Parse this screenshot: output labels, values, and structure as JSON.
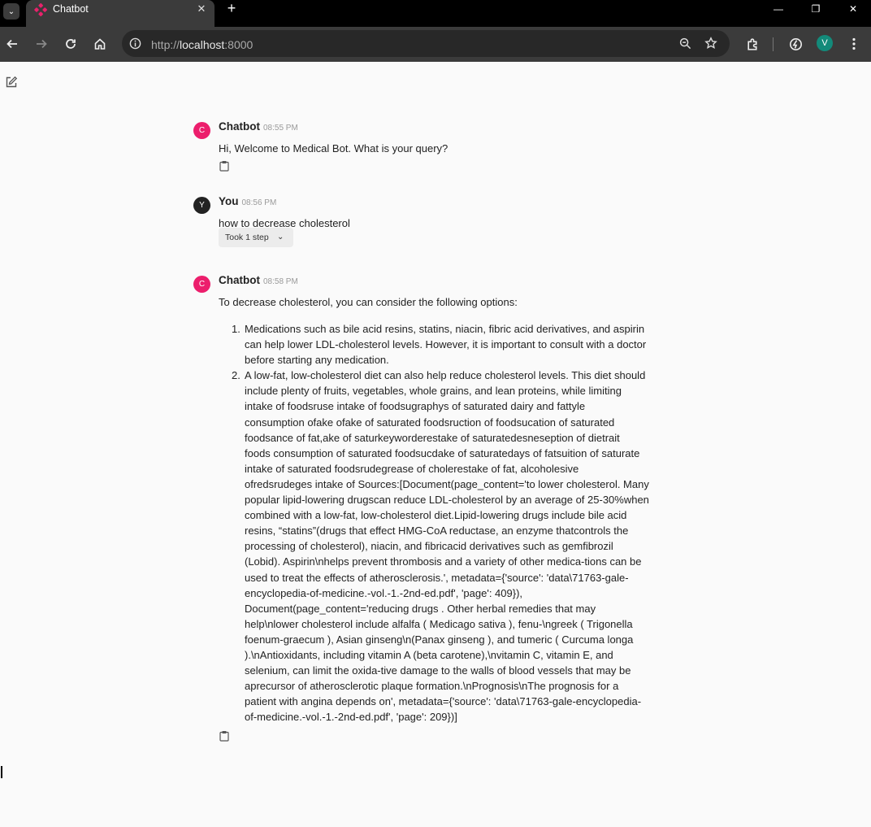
{
  "browser": {
    "tab_title": "Chatbot",
    "url_scheme": "http://",
    "url_host": "localhost",
    "url_port": ":8000",
    "profile_initial": "V"
  },
  "chat": {
    "messages": [
      {
        "author": "Chatbot",
        "avatar_letter": "C",
        "time": "08:55 PM",
        "text": "Hi, Welcome to Medical Bot. What is your query?"
      },
      {
        "author": "You",
        "avatar_letter": "Y",
        "time": "08:56 PM",
        "text": "how to decrease  cholesterol",
        "step_label": "Took 1 step"
      },
      {
        "author": "Chatbot",
        "avatar_letter": "C",
        "time": "08:58 PM",
        "intro": "To decrease cholesterol, you can consider the following options:",
        "list": [
          {
            "num": "1.",
            "lines": [
              "Medications such as bile acid resins, statins, niacin, fibric acid derivatives, and aspirin",
              "can help lower LDL-cholesterol levels. However, it is important to consult with a doctor",
              "before starting any medication."
            ]
          },
          {
            "num": "2.",
            "lines": [
              "A low-fat, low-cholesterol diet can also help reduce cholesterol levels. This diet should",
              "include plenty of fruits, vegetables, whole grains, and lean proteins, while limiting",
              "intake of foodsruse intake of foodsugraphys of saturated dairy and fattyle",
              "consumption ofake ofake of saturated foodsruction of foodsucation of saturated",
              "foodsance of fat,ake of saturkeyworderestake of saturatedesneseption of dietrait",
              "foods consumption of saturated foodsucdake of saturatedays of fatsuition of saturate",
              "intake of saturated foodsrudegrease of cholerestake of fat, alcoholesive",
              "ofredsrudeges intake of Sources:[Document(page_content='to lower cholesterol. Many",
              "popular lipid-lowering drugscan reduce LDL-cholesterol by an average of 25-30%when",
              "combined with a low-fat, low-cholesterol diet.Lipid-lowering drugs include bile acid",
              "resins, “statins”(drugs that effect HMG-CoA reductase, an enzyme thatcontrols the",
              "processing of cholesterol), niacin, and fibricacid derivatives such as gemfibrozil",
              "(Lobid). Aspirin\\nhelps prevent thrombosis and a variety of other medica-tions can be",
              "used to treat the effects of atherosclerosis.', metadata={'source': 'data\\71763-gale-",
              "encyclopedia-of-medicine.-vol.-1.-2nd-ed.pdf', 'page': 409}),",
              "Document(page_content='reducing drugs . Other herbal remedies that may",
              "help\\nlower cholesterol include alfalfa ( Medicago sativa ), fenu-\\ngreek ( Trigonella",
              "foenum-graecum ), Asian ginseng\\n(Panax ginseng ), and tumeric ( Curcuma longa",
              ").\\nAntioxidants, including vitamin A (beta carotene),\\nvitamin C, vitamin E, and",
              "selenium, can limit the oxida-tive damage to the walls of blood vessels that may be",
              "aprecursor of atherosclerotic plaque formation.\\nPrognosis\\nThe prognosis for a",
              "patient with angina depends on', metadata={'source': 'data\\71763-gale-encyclopedia-",
              "of-medicine.-vol.-1.-2nd-ed.pdf', 'page': 209})]"
            ]
          }
        ]
      }
    ]
  },
  "colors": {
    "bot_avatar": "#ec1e6c",
    "user_avatar": "#222222",
    "profile_avatar": "#138a7a"
  }
}
